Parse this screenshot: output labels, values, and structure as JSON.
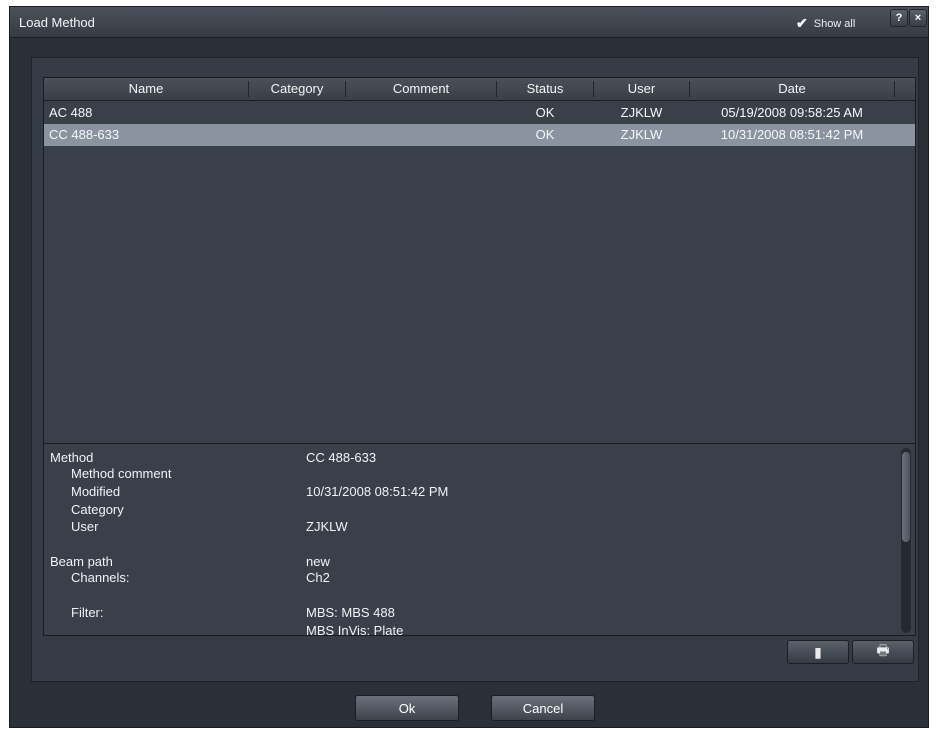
{
  "window": {
    "title": "Load Method",
    "show_all_label": "Show all",
    "help_label": "?",
    "close_label": "×"
  },
  "table": {
    "columns": [
      "Name",
      "Category",
      "Comment",
      "Status",
      "User",
      "Date"
    ],
    "rows": [
      {
        "name": "AC 488",
        "category": "",
        "comment": "",
        "status": "OK",
        "user": "ZJKLW",
        "date": "05/19/2008 09:58:25 AM",
        "selected": false
      },
      {
        "name": "CC 488-633",
        "category": "",
        "comment": "",
        "status": "OK",
        "user": "ZJKLW",
        "date": "10/31/2008 08:51:42 PM",
        "selected": true
      }
    ]
  },
  "details": {
    "method_label": "Method",
    "method_value": "CC 488-633",
    "method_comment_label": "Method comment",
    "method_comment_value": "",
    "modified_label": "Modified",
    "modified_value": "10/31/2008 08:51:42 PM",
    "category_label": "Category",
    "category_value": "",
    "user_label": "User",
    "user_value": "ZJKLW",
    "beam_path_label": "Beam path",
    "beam_path_value": "new",
    "channels_label": "Channels:",
    "channels_value": "Ch2",
    "filter_label": "Filter:",
    "filter_value": "MBS:  MBS 488",
    "filter_value_2": "MBS InVis:  Plate"
  },
  "actions": {
    "ok_label": "Ok",
    "cancel_label": "Cancel"
  },
  "icons": {
    "copy": "clipboard-icon",
    "print": "printer-icon"
  }
}
